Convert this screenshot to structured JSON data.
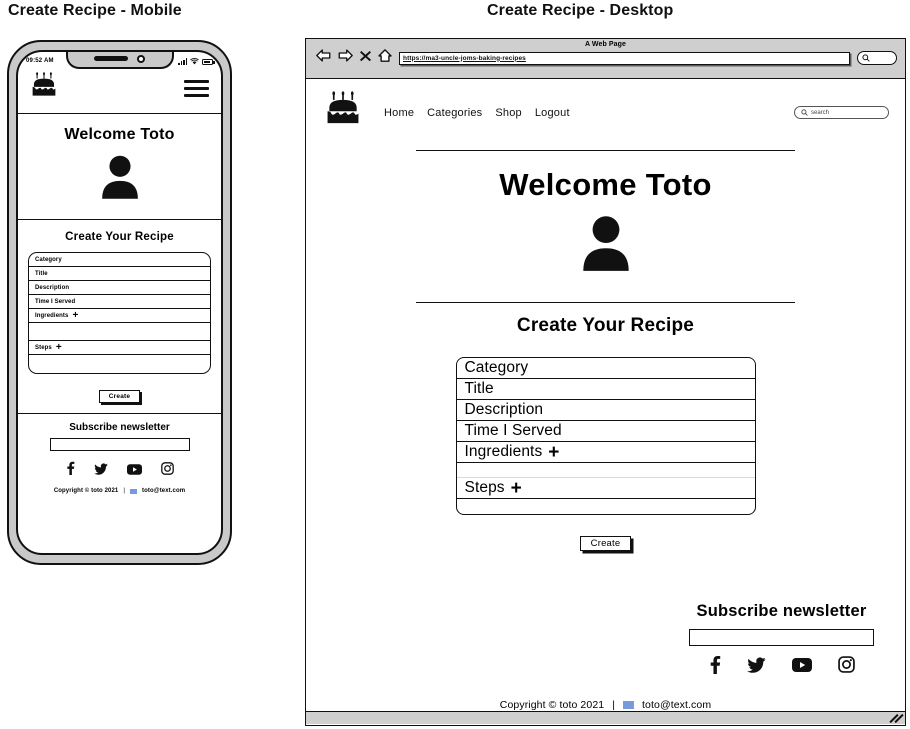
{
  "captions": {
    "mobile": "Create Recipe - Mobile",
    "desktop": "Create Recipe - Desktop"
  },
  "mobile": {
    "status_bar": {
      "time": "09:52 AM",
      "signal_icon": "signal-icon",
      "wifi_icon": "wifi-icon",
      "battery_icon": "battery-icon"
    },
    "nav": {
      "logo_icon": "cake-logo-icon",
      "menu_icon": "hamburger-menu-icon"
    },
    "hero": {
      "welcome": "Welcome Toto",
      "avatar_icon": "user-avatar-icon"
    },
    "section_title": "Create Your Recipe",
    "form": {
      "rows": [
        {
          "label": "Category",
          "plus": false
        },
        {
          "label": "Title",
          "plus": false
        },
        {
          "label": "Description",
          "plus": false
        },
        {
          "label": "Time I Served",
          "plus": false
        },
        {
          "label": "Ingredients",
          "plus": true
        },
        {
          "label": "",
          "plus": false
        },
        {
          "label": "Steps",
          "plus": true
        },
        {
          "label": "",
          "plus": false
        }
      ],
      "plus_glyph": "+"
    },
    "create_button": "Create",
    "footer": {
      "subscribe_title": "Subscribe newsletter",
      "subscribe_placeholder": "",
      "subscribe_value": "",
      "social": [
        {
          "name": "facebook-icon",
          "glyph": "f"
        },
        {
          "name": "twitter-icon",
          "glyph": "twitter"
        },
        {
          "name": "youtube-icon",
          "glyph": "youtube"
        },
        {
          "name": "instagram-icon",
          "glyph": "instagram"
        }
      ],
      "copyright": "Copyright © toto 2021",
      "separator": "|",
      "email": "toto@text.com"
    }
  },
  "desktop": {
    "browser": {
      "window_title": "A Web Page",
      "url": "https://ma3-uncle-joms-baking-recipes",
      "back_icon": "back-arrow-icon",
      "forward_icon": "forward-arrow-icon",
      "stop_icon": "stop-close-icon",
      "home_icon": "home-icon",
      "chrome_search_icon": "search-icon",
      "resize_grip_icon": "resize-grip-icon"
    },
    "nav": {
      "logo_icon": "cake-logo-icon",
      "links": [
        "Home",
        "Categories",
        "Shop",
        "Logout"
      ],
      "search_placeholder": "search",
      "search_icon": "search-icon"
    },
    "hero": {
      "welcome": "Welcome Toto",
      "avatar_icon": "user-avatar-icon"
    },
    "section_title": "Create Your Recipe",
    "form": {
      "rows": [
        {
          "label": "Category",
          "plus": false
        },
        {
          "label": "Title",
          "plus": false
        },
        {
          "label": "Description",
          "plus": false
        },
        {
          "label": "Time I Served",
          "plus": false
        },
        {
          "label": "Ingredients",
          "plus": true
        },
        {
          "label": "",
          "plus": false
        },
        {
          "label": "Steps",
          "plus": true
        },
        {
          "label": "",
          "plus": false
        }
      ],
      "plus_glyph": "+"
    },
    "create_button": "Create",
    "footer": {
      "subscribe_title": "Subscribe newsletter",
      "subscribe_placeholder": "",
      "subscribe_value": "",
      "social": [
        {
          "name": "facebook-icon",
          "glyph": "f"
        },
        {
          "name": "twitter-icon",
          "glyph": "twitter"
        },
        {
          "name": "youtube-icon",
          "glyph": "youtube"
        },
        {
          "name": "instagram-icon",
          "glyph": "instagram"
        }
      ],
      "copyright": "Copyright © toto 2021",
      "separator": "|",
      "email": "toto@text.com"
    }
  },
  "colors": {
    "ink": "#111111",
    "chrome": "#cfcfcf",
    "phone_body": "#c9c9c9",
    "mail_chip": "#7799dd"
  }
}
